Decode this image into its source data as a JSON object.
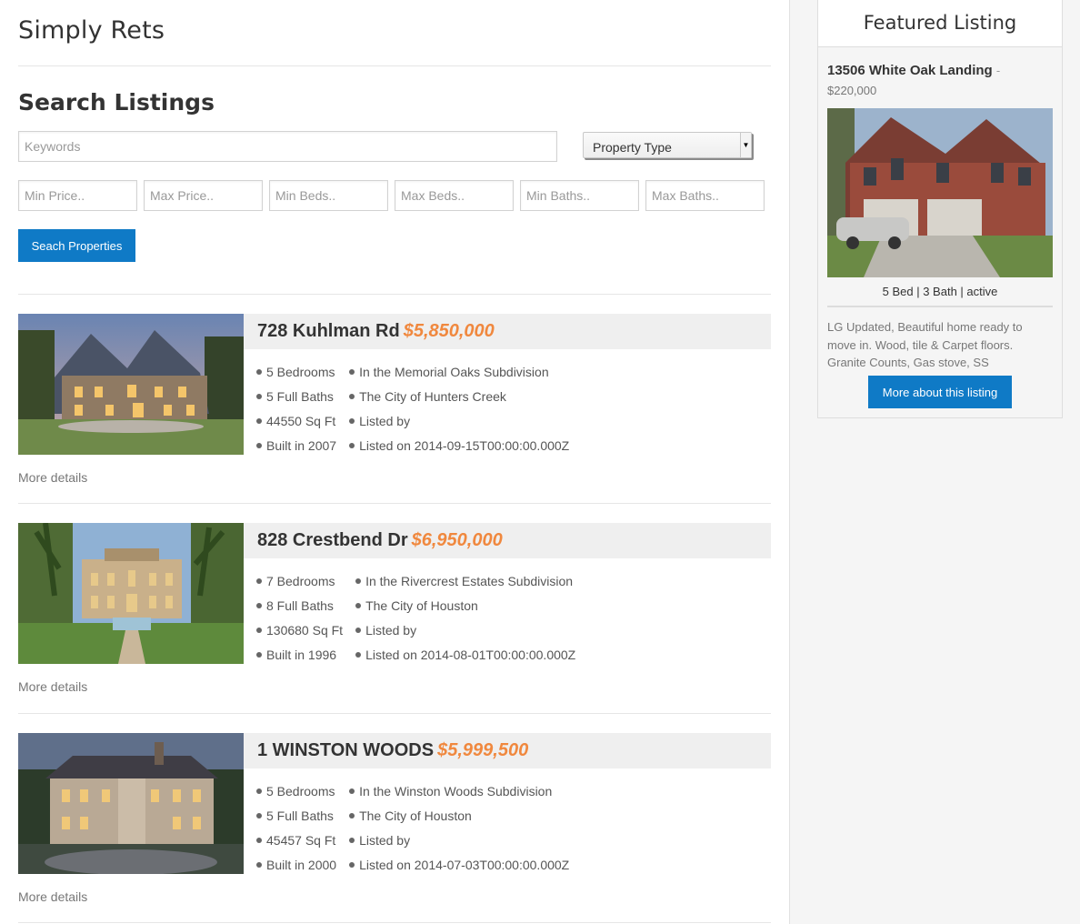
{
  "site": {
    "title": "Simply Rets"
  },
  "search": {
    "title": "Search Listings",
    "keywords_placeholder": "Keywords",
    "property_type_label": "Property Type",
    "min_price_placeholder": "Min Price..",
    "max_price_placeholder": "Max Price..",
    "min_beds_placeholder": "Min Beds..",
    "max_beds_placeholder": "Max Beds..",
    "min_baths_placeholder": "Min Baths..",
    "max_baths_placeholder": "Max Baths..",
    "button_label": "Seach Properties"
  },
  "listings": [
    {
      "address": "728 Kuhlman Rd",
      "price": "$5,850,000",
      "bedrooms": "5 Bedrooms",
      "baths": "5 Full Baths",
      "sqft": "44550 Sq Ft",
      "built": "Built in 2007",
      "subdivision": "In the Memorial Oaks Subdivision",
      "city": "The City of Hunters Creek",
      "listed_by": "Listed by",
      "listed_on": "Listed on 2014-09-15T00:00:00.000Z",
      "more_label": "More details"
    },
    {
      "address": "828 Crestbend Dr",
      "price": "$6,950,000",
      "bedrooms": "7 Bedrooms",
      "baths": "8 Full Baths",
      "sqft": "130680 Sq Ft",
      "built": "Built in 1996",
      "subdivision": "In the Rivercrest Estates Subdivision",
      "city": "The City of Houston",
      "listed_by": "Listed by",
      "listed_on": "Listed on 2014-08-01T00:00:00.000Z",
      "more_label": "More details"
    },
    {
      "address": "1 WINSTON WOODS",
      "price": "$5,999,500",
      "bedrooms": "5 Bedrooms",
      "baths": "5 Full Baths",
      "sqft": "45457 Sq Ft",
      "built": "Built in 2000",
      "subdivision": "In the Winston Woods Subdivision",
      "city": "The City of Houston",
      "listed_by": "Listed by",
      "listed_on": "Listed on 2014-07-03T00:00:00.000Z",
      "more_label": "More details"
    }
  ],
  "featured": {
    "title": "Featured Listing",
    "address": "13506 White Oak Landing",
    "separator": "-",
    "price": "$220,000",
    "stats": "5 Bed | 3 Bath | active",
    "description": "LG Updated, Beautiful home ready to move in. Wood, tile & Carpet floors. Granite Counts, Gas stove, SS",
    "button_label": "More about this listing"
  },
  "colors": {
    "accent": "#0f7ac6",
    "price": "#f0883e",
    "header_bar": "#efefef"
  }
}
